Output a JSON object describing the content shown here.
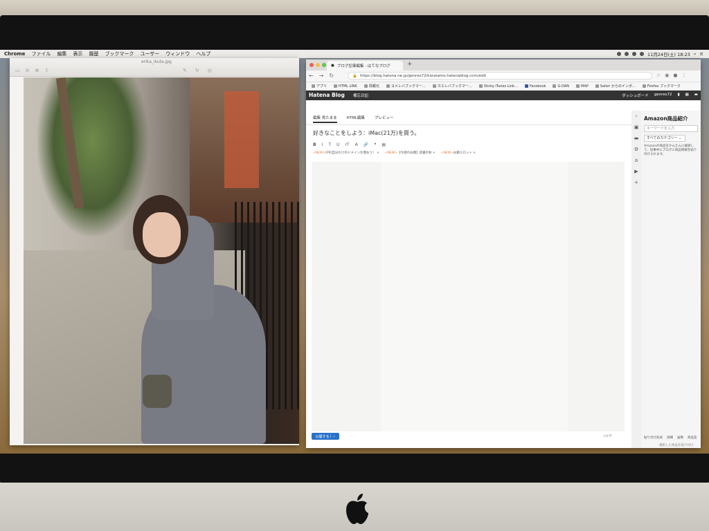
{
  "menubar": {
    "app": "Chrome",
    "items": [
      "ファイル",
      "編集",
      "表示",
      "履歴",
      "ブックマーク",
      "ユーザー",
      "ウィンドウ",
      "ヘルプ"
    ],
    "clock": "11月24日(土) 18:23"
  },
  "preview": {
    "filename": "erika_ikuta.jpg"
  },
  "chrome": {
    "tab_title": "ブログ記事編集 - はてなブログ",
    "url": "https://blog.hatena.ne.jp/genres72/kizukamo.hatenablog.com/edit",
    "bookmarks": [
      "アプリ",
      "HTML LINK",
      "情報元",
      "ヨメレバブックマー…",
      "カエレバブックマー…",
      "Sticky iTunes Link…",
      "Facebook",
      "G-DAN",
      "MAP",
      "Safari からのインポ…",
      "Firefox ブックマーク"
    ]
  },
  "hatena": {
    "logo": "Hatena Blog",
    "blog_name": "備忘日記",
    "dashboard": "ダッシュボード",
    "user": "genres72"
  },
  "editor": {
    "tabs": [
      "編集 見たまま",
      "HTML編集",
      "プレビュー"
    ],
    "title": "好きなことをしよう：iMac(21万)を買う。",
    "format_tools": [
      "B",
      "I",
      "T",
      "U",
      "rT",
      "A"
    ],
    "related_links": [
      {
        "tag": "<NEW>",
        "text": "[PR]自分だけのドメインを使おう！"
      },
      {
        "tag": "<NEW>",
        "text": "【今週のお題】読書の秋"
      },
      {
        "tag": "<NEW>",
        "text": "お題スロット"
      }
    ],
    "publish_label": "公開する",
    "char_count": "0文字"
  },
  "amazon": {
    "title": "Amazon商品紹介",
    "keyword_placeholder": "キーワードを入力",
    "category": "すべてのカテゴリー",
    "description": "Amazonの商品をかんたんに検索して、記事中にブログに商品情報を貼り付けられます。",
    "paste_format_label": "貼り付け形式",
    "formats": [
      "詳細",
      "画像",
      "商品名"
    ],
    "paste_action": "選択した商品を貼り付け"
  },
  "colors": {
    "publish": "#2a73c9",
    "hatena_bar": "#333333",
    "tag": "#e07b3a"
  }
}
